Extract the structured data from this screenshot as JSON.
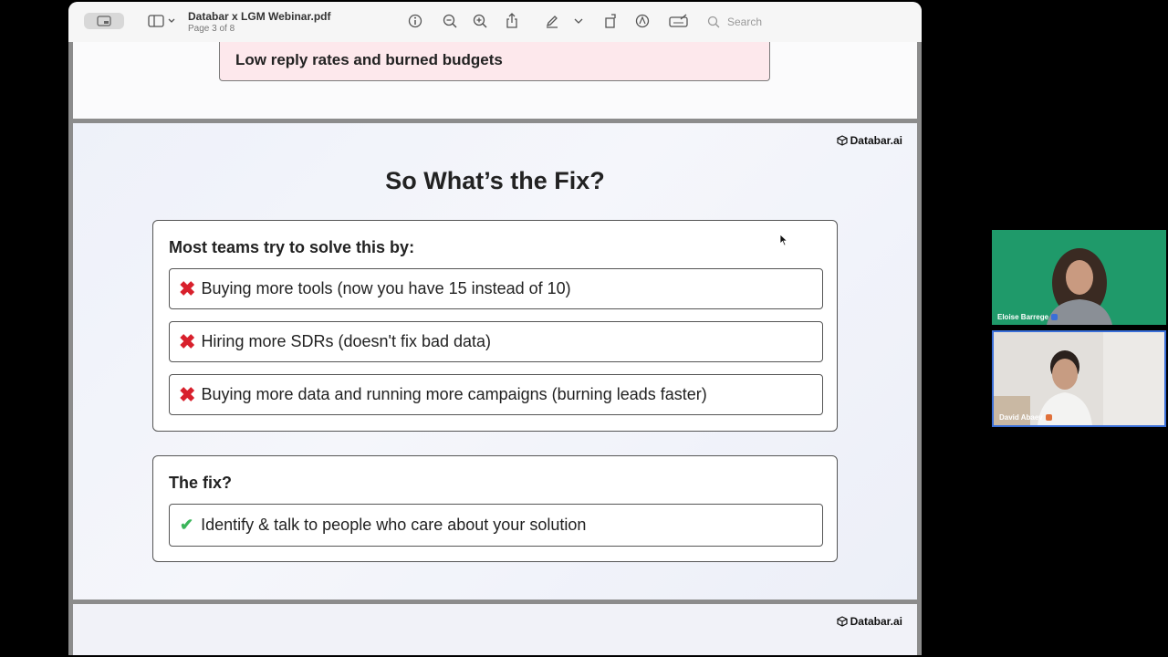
{
  "viewer": {
    "document_title": "Databar x LGM Webinar.pdf",
    "page_indicator": "Page 3 of 8",
    "search_placeholder": "Search"
  },
  "prev_page": {
    "callout": "Low reply rates and burned budgets"
  },
  "slide": {
    "brand": "Databar.ai",
    "title": "So What’s the Fix?",
    "problems_heading": "Most teams try to solve this by:",
    "problems": [
      "Buying more tools (now you have 15 instead of 10)",
      "Hiring more SDRs (doesn't fix bad data)",
      "Buying more data and running more campaigns (burning leads faster)"
    ],
    "fix_heading": "The fix?",
    "fix": "Identify & talk to people who care about your solution"
  },
  "next_page": {
    "brand": "Databar.ai"
  },
  "participants": [
    {
      "name": "Eloise Barrege",
      "badge_color": "#3a6fd8"
    },
    {
      "name": "David Abaev",
      "badge_color": "#e0703a"
    }
  ],
  "colors": {
    "x_mark": "#d8202c",
    "check": "#3bb55a",
    "callout_bg": "#fde8ec"
  },
  "icons": [
    "sidebar-icon",
    "info-icon",
    "zoom-out-icon",
    "zoom-in-icon",
    "share-icon",
    "pen-icon",
    "rotate-icon",
    "markup-icon",
    "signature-icon",
    "search-icon",
    "cube-logo-icon"
  ]
}
